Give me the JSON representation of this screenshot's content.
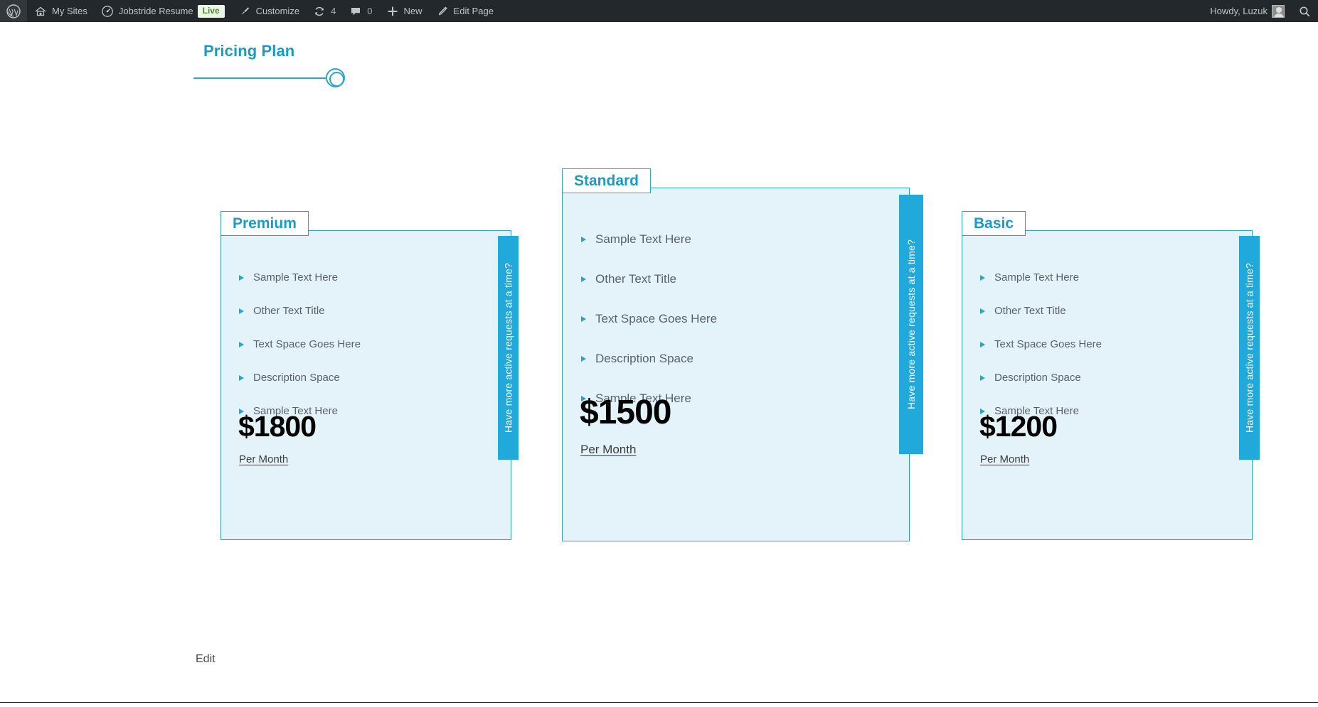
{
  "adminbar": {
    "wp_logo": "wordpress-logo-icon",
    "items": [
      {
        "icon": "sites-icon",
        "label": "My Sites"
      },
      {
        "icon": "dashboard-icon",
        "label": "Jobstride Resume",
        "badge": "Live"
      },
      {
        "icon": "paintbrush-icon",
        "label": "Customize"
      },
      {
        "icon": "updates-icon",
        "label": "4"
      },
      {
        "icon": "comment-icon",
        "label": "0"
      },
      {
        "icon": "plus-icon",
        "label": "New"
      },
      {
        "icon": "pencil-icon",
        "label": "Edit Page"
      }
    ],
    "howdy": "Howdy, Luzuk",
    "avatar": "user-avatar",
    "search": "search-icon"
  },
  "section": {
    "title": "Pricing Plan"
  },
  "plans": [
    {
      "name": "Premium",
      "features": [
        "Sample Text Here",
        "Other Text Title",
        "Text Space Goes Here",
        "Description Space",
        "Sample Text Here"
      ],
      "price": "$1800",
      "period": "Per Month",
      "ribbon": "Have more active requests at a time?"
    },
    {
      "name": "Standard",
      "features": [
        "Sample Text Here",
        "Other Text Title",
        "Text Space Goes Here",
        "Description Space",
        "Sample Text Here"
      ],
      "price": "$1500",
      "period": "Per Month",
      "ribbon": "Have more active requests at a time?"
    },
    {
      "name": "Basic",
      "features": [
        "Sample Text Here",
        "Other Text Title",
        "Text Space Goes Here",
        "Description Space",
        "Sample Text Here"
      ],
      "price": "$1200",
      "period": "Per Month",
      "ribbon": "Have more active requests at a time?"
    }
  ],
  "footer": {
    "edit_label": "Edit"
  },
  "colors": {
    "accent": "#2fa2c6",
    "ribbon": "#22a9dc",
    "card_bg": "#e4f3f9",
    "adminbar_bg": "#23282d",
    "live_badge_bg": "#edf7e6",
    "live_badge_text": "#4c8a2e"
  }
}
